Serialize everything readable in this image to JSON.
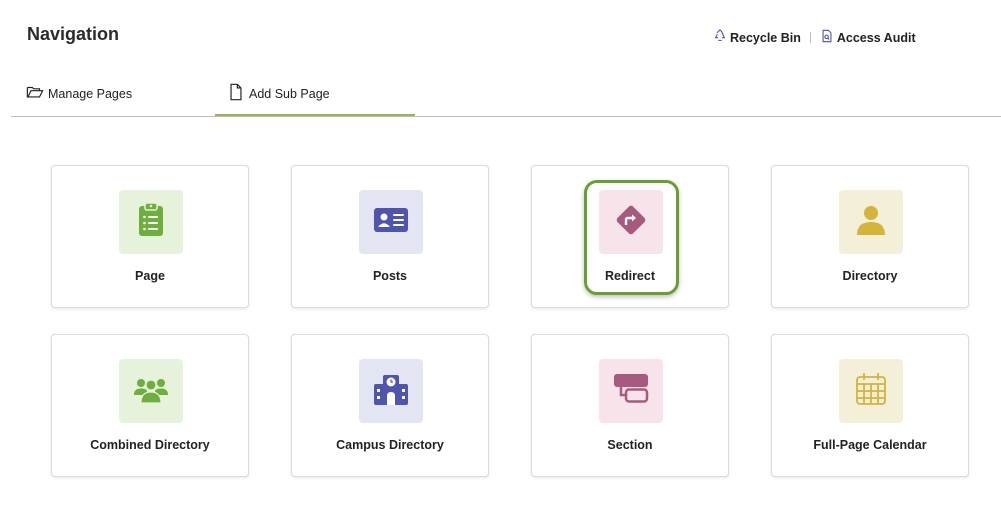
{
  "header": {
    "title": "Navigation",
    "actions": [
      {
        "label": "Recycle Bin",
        "icon": "recycle-icon"
      },
      {
        "label": "Access Audit",
        "icon": "document-search-icon"
      }
    ]
  },
  "tabs": [
    {
      "label": "Manage Pages",
      "icon": "folder-open-icon",
      "active": false
    },
    {
      "label": "Add Sub Page",
      "icon": "file-icon",
      "active": true
    }
  ],
  "page_types": [
    {
      "label": "Page",
      "icon": "clipboard-list-icon",
      "tile_color": "#e6f2d9",
      "icon_color": "#6dae3c"
    },
    {
      "label": "Posts",
      "icon": "id-card-icon",
      "tile_color": "#e3e5f3",
      "icon_color": "#4f54ad"
    },
    {
      "label": "Redirect",
      "icon": "directions-sign-icon",
      "tile_color": "#f6e4ea",
      "icon_color": "#a85a7e",
      "highlighted": true
    },
    {
      "label": "Directory",
      "icon": "user-icon",
      "tile_color": "#f3efd9",
      "icon_color": "#d4b43a"
    },
    {
      "label": "Combined Directory",
      "icon": "users-icon",
      "tile_color": "#e6f2d9",
      "icon_color": "#6dae3c"
    },
    {
      "label": "Campus Directory",
      "icon": "school-building-icon",
      "tile_color": "#e3e5f3",
      "icon_color": "#4f54ad"
    },
    {
      "label": "Section",
      "icon": "section-blocks-icon",
      "tile_color": "#f6e4ea",
      "icon_color": "#a85a7e"
    },
    {
      "label": "Full-Page Calendar",
      "icon": "calendar-icon",
      "tile_color": "#f3efd9",
      "icon_color": "#d4b43a"
    }
  ],
  "colors": {
    "highlight_border": "#6a9e2f",
    "active_tab_underline": "#9bb35a"
  }
}
